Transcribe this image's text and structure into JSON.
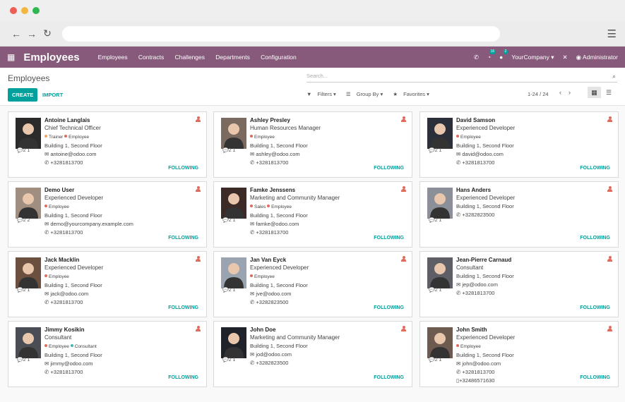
{
  "app": {
    "title": "Employees",
    "menu": [
      "Employees",
      "Contracts",
      "Challenges",
      "Departments",
      "Configuration"
    ],
    "company": "YourCompany ▾",
    "user": "Administrator",
    "activity_count": "16",
    "message_count": "2"
  },
  "control": {
    "breadcrumb": "Employees",
    "search_placeholder": "Search...",
    "create": "CREATE",
    "import": "IMPORT",
    "filters": "Filters ▾",
    "group_by": "Group By ▾",
    "favorites": "Favorites ▾",
    "pager": "1-24 / 24"
  },
  "colors": {
    "brand": "#875a7b",
    "accent": "#00a09d",
    "tag_orange": "#f0a35e",
    "tag_red": "#e06b5c",
    "tag_teal": "#3fb8af"
  },
  "employees": [
    {
      "name": "Antoine Langlais",
      "job": "Chief Technical Officer",
      "tags": [
        {
          "label": "Trainer",
          "color": "#f0a35e"
        },
        {
          "label": "Employee",
          "color": "#e06b5c"
        }
      ],
      "location": "Building 1, Second Floor",
      "email": "antoine@odoo.com",
      "phone": "+3281813700",
      "counts": "2 1",
      "following": "FOLLOWING"
    },
    {
      "name": "Ashley Presley",
      "job": "Human Resources Manager",
      "tags": [
        {
          "label": "Employee",
          "color": "#e06b5c"
        }
      ],
      "location": "Building 1, Second Floor",
      "email": "ashley@odoo.com",
      "phone": "+3281813700",
      "counts": "2 1",
      "following": "FOLLOWING"
    },
    {
      "name": "David Samson",
      "job": "Experienced Developer",
      "tags": [
        {
          "label": "Employee",
          "color": "#e06b5c"
        }
      ],
      "location": "Building 1, Second Floor",
      "email": "david@odoo.com",
      "phone": "+3281813700",
      "counts": "2 1",
      "following": "FOLLOWING"
    },
    {
      "name": "Demo User",
      "job": "Experienced Developer",
      "tags": [
        {
          "label": "Employee",
          "color": "#e06b5c"
        }
      ],
      "location": "Building 1, Second Floor",
      "email": "demo@yourcompany.example.com",
      "phone": "+3281813700",
      "counts": "2 2",
      "following": "FOLLOWING"
    },
    {
      "name": "Famke Jenssens",
      "job": "Marketing and Community Manager",
      "tags": [
        {
          "label": "Sales",
          "color": "#e06b5c"
        },
        {
          "label": "Employee",
          "color": "#e06b5c"
        }
      ],
      "location": "Building 1, Second Floor",
      "email": "famke@odoo.com",
      "phone": "+3281813700",
      "counts": "2 1",
      "following": "FOLLOWING"
    },
    {
      "name": "Hans Anders",
      "job": "Experienced Developer",
      "tags": [],
      "location": "Building 1, Second Floor",
      "email": "",
      "phone": "+3282823500",
      "counts": "2 1",
      "following": "FOLLOWING"
    },
    {
      "name": "Jack Macklin",
      "job": "Experienced Developer",
      "tags": [
        {
          "label": "Employee",
          "color": "#e06b5c"
        }
      ],
      "location": "Building 1, Second Floor",
      "email": "jack@odoo.com",
      "phone": "+3281813700",
      "counts": "2 1",
      "following": "FOLLOWING"
    },
    {
      "name": "Jan Van Eyck",
      "job": "Experienced Developer",
      "tags": [
        {
          "label": "Employee",
          "color": "#e06b5c"
        }
      ],
      "location": "Building 1, Second Floor",
      "email": "jve@odoo.com",
      "phone": "+3282823500",
      "counts": "2 1",
      "following": "FOLLOWING"
    },
    {
      "name": "Jean-Pierre Carnaud",
      "job": "Consultant",
      "tags": [],
      "location": "Building 1, Second Floor",
      "email": "jep@odoo.com",
      "phone": "+3281813700",
      "counts": "2 1",
      "following": "FOLLOWING"
    },
    {
      "name": "Jimmy Kosikin",
      "job": "Consultant",
      "tags": [
        {
          "label": "Employee",
          "color": "#e06b5c"
        },
        {
          "label": "Consultant",
          "color": "#3fb8af"
        }
      ],
      "location": "Building 1, Second Floor",
      "email": "jimmy@odoo.com",
      "phone": "+3281813700",
      "counts": "2 1",
      "following": "FOLLOWING"
    },
    {
      "name": "John Doe",
      "job": "Marketing and Community Manager",
      "tags": [],
      "location": "Building 1, Second Floor",
      "email": "jod@odoo.com",
      "phone": "+3282823500",
      "counts": "2 1",
      "following": "FOLLOWING"
    },
    {
      "name": "John Smith",
      "job": "Experienced Developer",
      "tags": [
        {
          "label": "Employee",
          "color": "#e06b5c"
        }
      ],
      "location": "Building 1, Second Floor",
      "email": "john@odoo.com",
      "phone": "+3281813700",
      "mobile": "+32486571630",
      "counts": "2 1",
      "following": "FOLLOWING"
    }
  ]
}
